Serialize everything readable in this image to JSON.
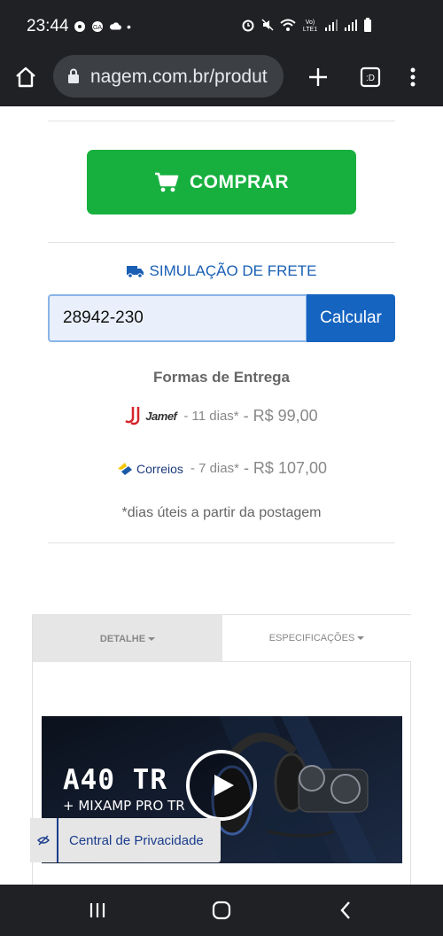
{
  "status": {
    "time": "23:44",
    "dot": "•"
  },
  "browser": {
    "url": "nagem.com.br/produt"
  },
  "product": {
    "buy_label": "COMPRAR"
  },
  "shipping": {
    "title": "SIMULAÇÃO DE FRETE",
    "cep_value": "28942-230",
    "calc_label": "Calcular",
    "options_heading": "Formas de Entrega",
    "options": [
      {
        "carrier": "Jamef",
        "days": "- 11 dias*",
        "price": "- R$ 99,00"
      },
      {
        "carrier": "Correios",
        "days": "- 7 dias*",
        "price": "- R$ 107,00"
      }
    ],
    "note": "*dias úteis a partir da postagem"
  },
  "tabs": [
    {
      "label": "DETALHE"
    },
    {
      "label": "ESPECIFICAÇÕES"
    }
  ],
  "video": {
    "title": "A40 TR",
    "subtitle": "+ MIXAMP PRO TR"
  },
  "privacy": {
    "label": "Central de Privacidade"
  },
  "colors": {
    "buy_green": "#17b03f",
    "link_blue": "#1a5fb4",
    "button_blue": "#1564c0"
  }
}
